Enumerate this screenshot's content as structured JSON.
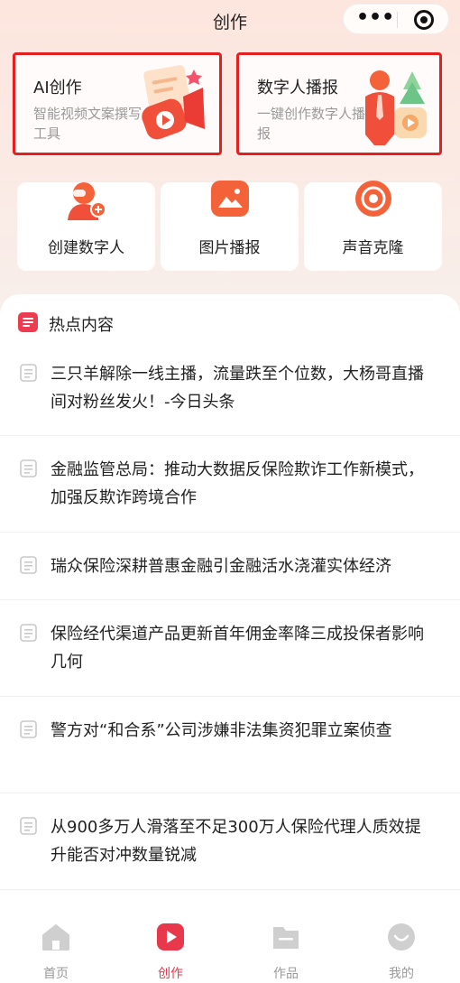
{
  "header": {
    "title": "创作",
    "more_glyph": "•••"
  },
  "features": [
    {
      "title": "AI创作",
      "desc": "智能视频文案撰写工具",
      "icon": "megaphone-icon"
    },
    {
      "title": "数字人播报",
      "desc": "一键创作数字人播报",
      "icon": "digital-person-icon"
    }
  ],
  "tools": [
    {
      "label": "创建数字人",
      "icon": "person-add-icon"
    },
    {
      "label": "图片播报",
      "icon": "image-icon"
    },
    {
      "label": "声音克隆",
      "icon": "sound-wave-icon"
    }
  ],
  "hot": {
    "title": "热点内容",
    "items": [
      "三只羊解除一线主播，流量跌至个位数，大杨哥直播间对粉丝发火！-今日头条",
      "金融监管总局：推动大数据反保险欺诈工作新模式，加强反欺诈跨境合作",
      "瑞众保险深耕普惠金融引金融活水浇灌实体经济",
      "保险经代渠道产品更新首年佣金率降三成投保者影响几何",
      "警方对“和合系”公司涉嫌非法集资犯罪立案侦查",
      "从900多万人滑落至不足300万人保险代理人质效提升能否对冲数量锐减"
    ]
  },
  "tabbar": [
    {
      "label": "首页",
      "icon": "home-icon",
      "active": false
    },
    {
      "label": "创作",
      "icon": "play-icon",
      "active": true
    },
    {
      "label": "作品",
      "icon": "folder-icon",
      "active": false
    },
    {
      "label": "我的",
      "icon": "profile-icon",
      "active": false
    }
  ],
  "colors": {
    "accent": "#e8384b",
    "highlight_border": "#e3201f",
    "muted_text": "#999999"
  }
}
